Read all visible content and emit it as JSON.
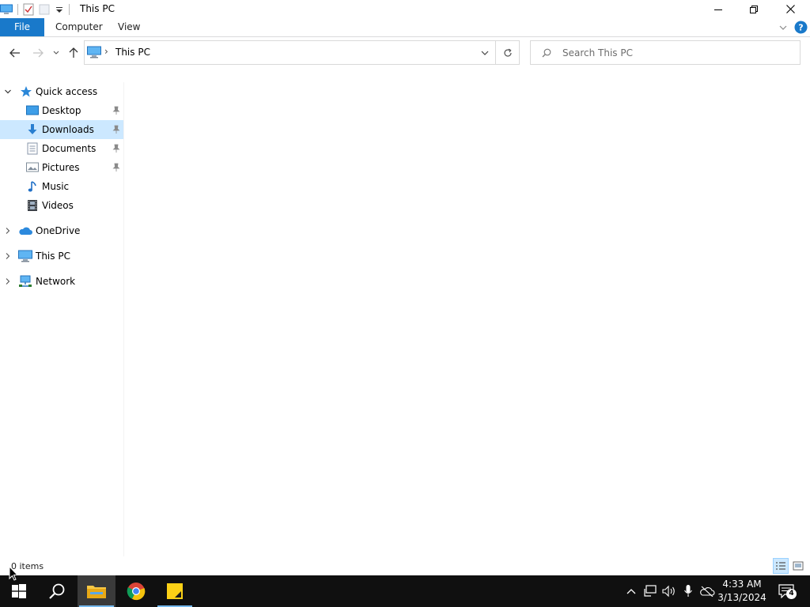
{
  "window": {
    "title": "This PC",
    "minimize_glyph": "—",
    "maximize_glyph": "❐",
    "close_glyph": "✕"
  },
  "ribbon": {
    "tabs": [
      {
        "label": "File"
      },
      {
        "label": "Computer"
      },
      {
        "label": "View"
      }
    ]
  },
  "address": {
    "path_segment": "This PC",
    "separator": "›",
    "icon": "this-pc-icon"
  },
  "search": {
    "placeholder": "Search This PC",
    "value": ""
  },
  "nav_pane": {
    "items": [
      {
        "label": "Quick access",
        "icon": "star-icon",
        "expanded": true
      },
      {
        "label": "Desktop",
        "icon": "desktop-folder-icon",
        "pinned": true
      },
      {
        "label": "Downloads",
        "icon": "download-arrow-icon",
        "pinned": true,
        "selected": true
      },
      {
        "label": "Documents",
        "icon": "documents-icon",
        "pinned": true
      },
      {
        "label": "Pictures",
        "icon": "pictures-icon",
        "pinned": true
      },
      {
        "label": "Music",
        "icon": "music-note-icon"
      },
      {
        "label": "Videos",
        "icon": "video-film-icon"
      },
      {
        "label": "OneDrive",
        "icon": "cloud-icon",
        "expanded": false
      },
      {
        "label": "This PC",
        "icon": "monitor-icon",
        "expanded": false
      },
      {
        "label": "Network",
        "icon": "network-icon",
        "expanded": false
      }
    ]
  },
  "status": {
    "item_count": "0 items"
  },
  "taskbar": {
    "time": "4:33 AM",
    "date": "3/13/2024",
    "notification_count": "4"
  },
  "colors": {
    "accent": "#1979ca",
    "selection": "#cce8ff",
    "taskbar": "#101010",
    "active_underline": "#76b9ed"
  }
}
